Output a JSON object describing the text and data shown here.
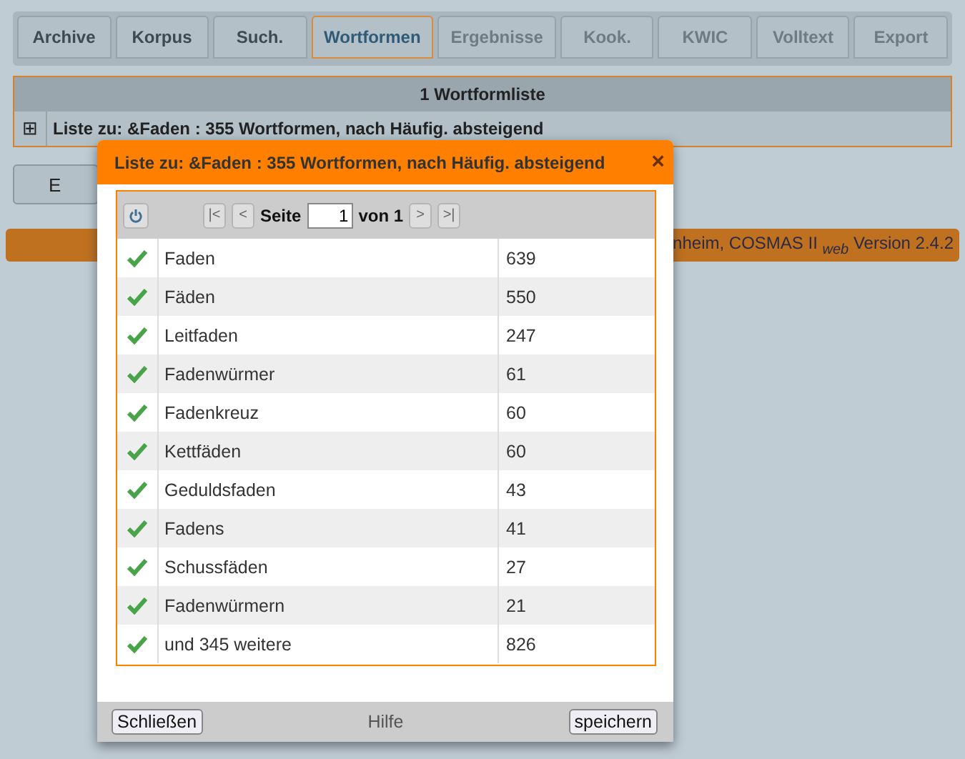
{
  "tabs": [
    {
      "label": "Archive",
      "selected": false,
      "disabled": false
    },
    {
      "label": "Korpus",
      "selected": false,
      "disabled": false
    },
    {
      "label": "Such.",
      "selected": false,
      "disabled": false
    },
    {
      "label": "Wortformen",
      "selected": true,
      "disabled": false
    },
    {
      "label": "Ergebnisse",
      "selected": false,
      "disabled": true
    },
    {
      "label": "Kook.",
      "selected": false,
      "disabled": true
    },
    {
      "label": "KWIC",
      "selected": false,
      "disabled": true
    },
    {
      "label": "Volltext",
      "selected": false,
      "disabled": true
    },
    {
      "label": "Export",
      "selected": false,
      "disabled": true
    }
  ],
  "panel": {
    "title": "1 Wortformliste",
    "expand_icon": "⊞",
    "row": "Liste zu: &Faden : 355 Wortformen, nach Häufig. absteigend"
  },
  "button": "E",
  "footer": "nheim, COSMAS II $_{web}$ Version 2.4.2",
  "dialog": {
    "title": "Liste zu: &Faden : 355 Wortformen, nach Häufig. absteigend",
    "close": "×",
    "pager": {
      "first": "|<",
      "prev": "<",
      "label": "Seite",
      "page": "1",
      "of": "von 1",
      "next": ">",
      "last": ">|"
    },
    "rows": [
      {
        "word": "Faden",
        "count": "639",
        "checked": true
      },
      {
        "word": "Fäden",
        "count": "550",
        "checked": true
      },
      {
        "word": "Leitfaden",
        "count": "247",
        "checked": true
      },
      {
        "word": "Fadenwürmer",
        "count": "61",
        "checked": true
      },
      {
        "word": "Fadenkreuz",
        "count": "60",
        "checked": true
      },
      {
        "word": "Kettfäden",
        "count": "60",
        "checked": true
      },
      {
        "word": "Geduldsfaden",
        "count": "43",
        "checked": true
      },
      {
        "word": "Fadens",
        "count": "41",
        "checked": true
      },
      {
        "word": "Schussfäden",
        "count": "27",
        "checked": true
      },
      {
        "word": "Fadenwürmern",
        "count": "21",
        "checked": true
      },
      {
        "word": "und 345 weitere",
        "count": "826",
        "checked": true
      }
    ],
    "buttons": {
      "close": "Schließen",
      "help": "Hilfe",
      "save": "speichern"
    }
  }
}
